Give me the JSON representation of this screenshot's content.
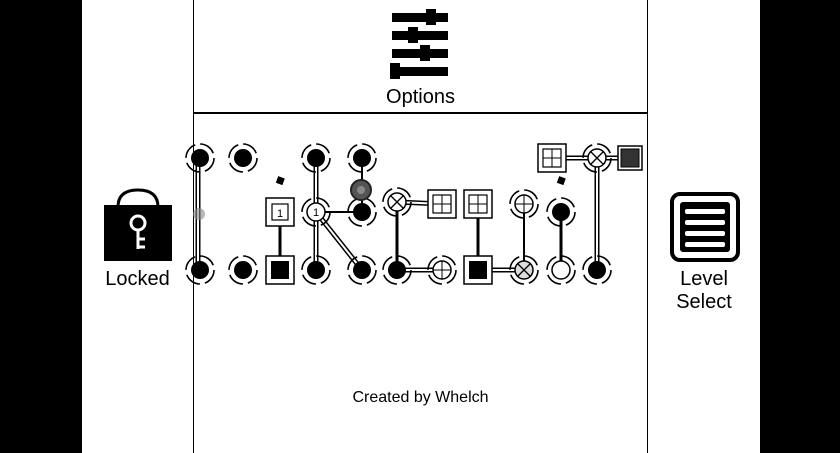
{
  "left_panel": {
    "label": "Locked",
    "icon": "padlock-key-icon"
  },
  "right_panel": {
    "label": "Level\nSelect",
    "icon": "list-icon"
  },
  "top_panel": {
    "label": "Options",
    "icon": "sliders-icon"
  },
  "footer": {
    "credit": "Created by Whelch"
  },
  "board": {
    "node_numbers": [
      "1",
      "1"
    ]
  },
  "colors": {
    "background": "#000000",
    "panel": "#ffffff",
    "ink": "#000000"
  }
}
